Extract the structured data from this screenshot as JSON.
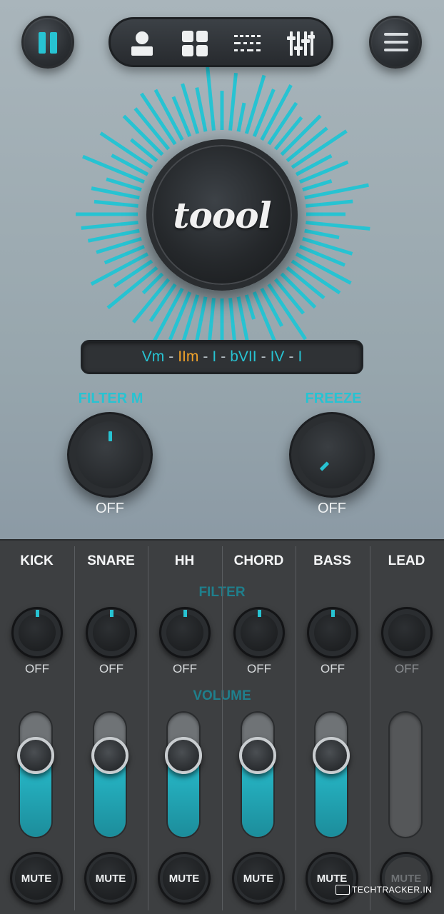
{
  "app": {
    "logo": "toool"
  },
  "topbar": {
    "pause": {
      "icon": "pause-icon"
    },
    "tabs": [
      {
        "icon": "user-icon"
      },
      {
        "icon": "grid-icon"
      },
      {
        "icon": "sequencer-icon"
      },
      {
        "icon": "sliders-icon"
      }
    ],
    "menu": {
      "icon": "menu-icon"
    }
  },
  "chord": {
    "parts": [
      "Vm",
      "IIm",
      "I",
      "bVII",
      "IV",
      "I"
    ],
    "separator": "-",
    "highlight_index": 1
  },
  "effects": {
    "filter": {
      "label": "FILTER M",
      "value": "OFF",
      "level": 0.5
    },
    "freeze": {
      "label": "FREEZE",
      "value": "OFF",
      "level": 0.0
    }
  },
  "mixer": {
    "filter_label": "FILTER",
    "volume_label": "VOLUME",
    "channels": [
      {
        "name": "KICK",
        "filter": "OFF",
        "volume": 0.65,
        "mute": "MUTE",
        "enabled": true
      },
      {
        "name": "SNARE",
        "filter": "OFF",
        "volume": 0.65,
        "mute": "MUTE",
        "enabled": true
      },
      {
        "name": "HH",
        "filter": "OFF",
        "volume": 0.65,
        "mute": "MUTE",
        "enabled": true
      },
      {
        "name": "CHORD",
        "filter": "OFF",
        "volume": 0.65,
        "mute": "MUTE",
        "enabled": true
      },
      {
        "name": "BASS",
        "filter": "OFF",
        "volume": 0.65,
        "mute": "MUTE",
        "enabled": true
      },
      {
        "name": "LEAD",
        "filter": "OFF",
        "volume": 0.0,
        "mute": "MUTE",
        "enabled": false
      }
    ]
  },
  "watermark": "TECHTRACKER.IN",
  "colors": {
    "accent": "#27c3d2",
    "highlight": "#f0a22a",
    "panel": "#3d3f41"
  }
}
